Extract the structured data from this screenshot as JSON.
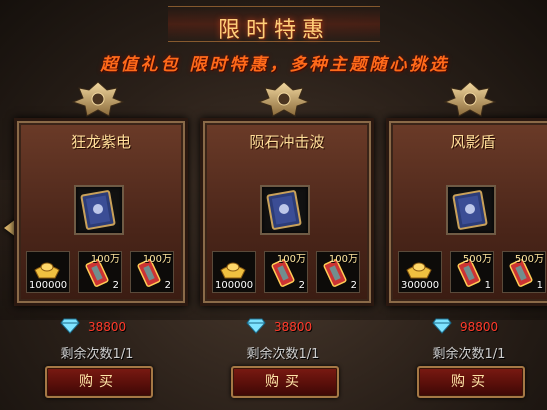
{
  "header": {
    "title": "限时特惠",
    "subtitle": "超值礼包  限时特惠，多种主题随心挑选"
  },
  "cards": [
    {
      "name": "狂龙紫电",
      "item_icon": "skill-book-icon",
      "rewards": [
        {
          "icon": "gold-ingot-icon",
          "top": "",
          "bottom": "100000"
        },
        {
          "icon": "scroll-icon",
          "top": "100万",
          "bottom": "2"
        },
        {
          "icon": "scroll-icon",
          "top": "100万",
          "bottom": "2"
        }
      ],
      "price": "38800",
      "remaining": "剩余次数1/1",
      "buy_label": "购买"
    },
    {
      "name": "陨石冲击波",
      "item_icon": "skill-book-icon",
      "rewards": [
        {
          "icon": "gold-ingot-icon",
          "top": "",
          "bottom": "100000"
        },
        {
          "icon": "scroll-icon",
          "top": "100万",
          "bottom": "2"
        },
        {
          "icon": "scroll-icon",
          "top": "100万",
          "bottom": "2"
        }
      ],
      "price": "38800",
      "remaining": "剩余次数1/1",
      "buy_label": "购买"
    },
    {
      "name": "风影盾",
      "item_icon": "skill-book-icon",
      "rewards": [
        {
          "icon": "gold-ingot-icon",
          "top": "",
          "bottom": "300000"
        },
        {
          "icon": "scroll-icon",
          "top": "500万",
          "bottom": "1"
        },
        {
          "icon": "scroll-icon",
          "top": "500万",
          "bottom": "1"
        }
      ],
      "price": "98800",
      "remaining": "剩余次数1/1",
      "buy_label": "购买"
    }
  ],
  "colors": {
    "title": "#ffcf7a",
    "subtitle": "#ff6a1a",
    "price": "#ff3a2a",
    "card": "#5a2e1e"
  }
}
